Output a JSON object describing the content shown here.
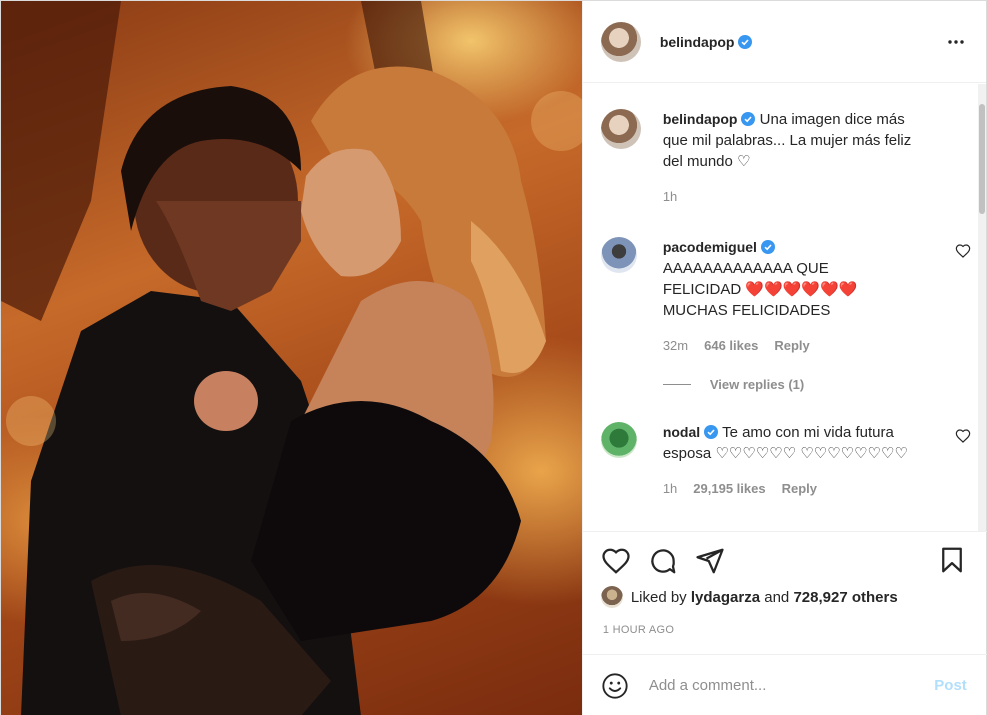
{
  "post": {
    "author": "belindapop",
    "caption": "Una imagen dice más que mil palabras... La mujer más feliz del mundo ♡",
    "caption_time": "1h",
    "comments": [
      {
        "username": "pacodemiguel",
        "text_line1": "AAAAAAAAAAAAA QUE",
        "text_line2_prefix": "FELICIDAD ",
        "text_line2_hearts": "❤️❤️❤️❤️❤️❤️",
        "text_line3": "MUCHAS FELICIDADES",
        "time": "32m",
        "likes": "646 likes",
        "reply": "Reply",
        "view_replies": "View replies (1)"
      },
      {
        "username": "nodal",
        "text": "Te amo con mi vida futura esposa ♡♡♡♡♡♡ ♡♡♡♡♡♡♡♡",
        "time": "1h",
        "likes": "29,195 likes",
        "reply": "Reply"
      }
    ],
    "liked_by_prefix": "Liked by",
    "liked_by_user": "lydagarza",
    "liked_by_and": "and",
    "liked_by_others": "728,927 others",
    "timestamp": "1 HOUR AGO",
    "add_comment_placeholder": "Add a comment...",
    "post_button": "Post"
  },
  "colors": {
    "verified": "#3897f0",
    "text": "#262626",
    "muted": "#8e8e8e",
    "post_button": "#b2dffc",
    "heart_red": "#ed4956"
  },
  "icons": [
    "verified-icon",
    "more-options-icon",
    "heart-icon",
    "comment-icon",
    "share-icon",
    "bookmark-icon",
    "emoji-icon"
  ]
}
